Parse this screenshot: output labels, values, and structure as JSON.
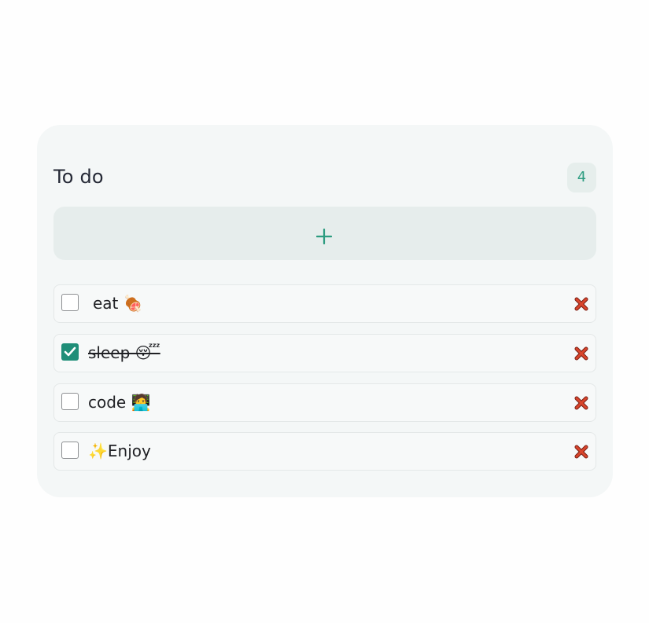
{
  "header": {
    "title": "To do",
    "count": "4"
  },
  "add_button": {
    "icon": "plus-icon",
    "color": "#2d9c80"
  },
  "todos": [
    {
      "text": "eat 🍖",
      "done": false
    },
    {
      "text": "sleep 😴",
      "done": true
    },
    {
      "text": "code 🧑‍💻",
      "done": false
    },
    {
      "text": "✨Enjoy",
      "done": false
    }
  ],
  "colors": {
    "accent": "#1f8e78",
    "delete": "#c0392b"
  }
}
